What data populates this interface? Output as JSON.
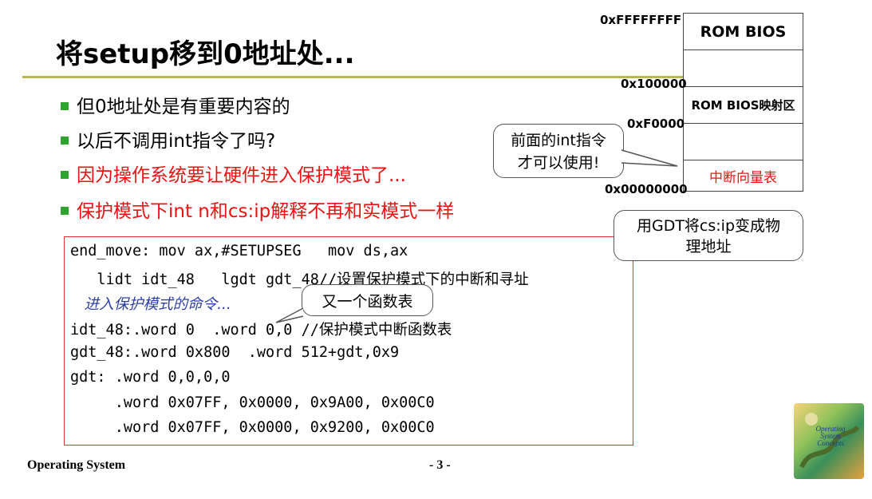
{
  "title": "将setup移到0地址处...",
  "bullets": [
    {
      "text": "但0地址处是有重要内容的",
      "color": "#000000"
    },
    {
      "text": "以后不调用int指令了吗?",
      "color": "#000000"
    },
    {
      "text": "因为操作系统要让硬件进入保护模式了...",
      "color": "#ee1111"
    },
    {
      "text": "保护模式下int n和cs:ip解释不再和实模式一样",
      "color": "#ee1111"
    }
  ],
  "code": {
    "line1": "end_move: mov ax,#SETUPSEG   mov ds,ax",
    "line2a": "   lidt idt_48   lgdt gdt_48//",
    "line2b": "设置保护模式下的中断和寻址",
    "line3": "   进入保护模式的命令...",
    "line4a": "idt_48:.word 0  .word 0,0 //",
    "line4b": "保护模式中断函数表",
    "line5": "gdt_48:.word 0x800  .word 512+gdt,0x9",
    "line6": "gdt: .word 0,0,0,0",
    "line7": "     .word 0x07FF, 0x0000, 0x9A00, 0x00C0",
    "line8": "     .word 0x07FF, 0x0000, 0x9200, 0x00C0"
  },
  "callouts": {
    "int_line1": "前面的int指令",
    "int_line2": "才可以使用!",
    "func_table": "又一个函数表",
    "gdt_line1": "用GDT将cs:ip变成物",
    "gdt_line2": "理地址"
  },
  "memory_map": {
    "addresses": [
      "0xFFFFFFFF",
      "0x100000",
      "0xF0000",
      "0x00000000"
    ],
    "cells": [
      "ROM BIOS",
      "",
      "ROM BIOS映射区",
      "",
      "中断向量表"
    ],
    "ivt_color": "#ee1111"
  },
  "footer": {
    "left": "Operating System",
    "page": "- 3 -"
  },
  "book": {
    "title_line1": "Operating",
    "title_line2": "System",
    "title_line3": "Concepts"
  }
}
